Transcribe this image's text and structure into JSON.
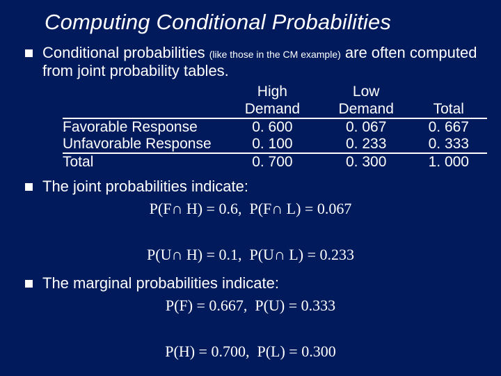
{
  "title": "Computing Conditional Probabilities",
  "bullets": {
    "b1_a": "Conditional probabilities ",
    "b1_small": "(like those in the CM example)",
    "b1_b": " are often computed from joint probability tables.",
    "b2": "The joint probabilities indicate:",
    "b3": "The marginal probabilities indicate:"
  },
  "table": {
    "col1_l1": "High",
    "col1_l2": "Demand",
    "col2_l1": "Low",
    "col2_l2": "Demand",
    "col3_l1": "",
    "col3_l2": "Total",
    "rows": [
      {
        "label": "Favorable Response",
        "c1": "0. 600",
        "c2": "0. 067",
        "c3": "0. 667"
      },
      {
        "label": "Unfavorable Response",
        "c1": "0. 100",
        "c2": "0. 233",
        "c3": "0. 333"
      },
      {
        "label": "Total",
        "c1": "0. 700",
        "c2": "0. 300",
        "c3": "1. 000"
      }
    ]
  },
  "formulas": {
    "joint_line1": "P(F∩ H) = 0.6,  P(F∩ L) = 0.067",
    "joint_line2": "P(U∩ H) = 0.1,  P(U∩ L) = 0.233",
    "marg_line1": "P(F) = 0.667,  P(U) = 0.333",
    "marg_line2": "P(H) = 0.700,  P(L) = 0.300"
  },
  "chart_data": {
    "type": "table",
    "title": "Joint probability table",
    "columns": [
      "",
      "High Demand",
      "Low Demand",
      "Total"
    ],
    "rows": [
      [
        "Favorable Response",
        0.6,
        0.067,
        0.667
      ],
      [
        "Unfavorable Response",
        0.1,
        0.233,
        0.333
      ],
      [
        "Total",
        0.7,
        0.3,
        1.0
      ]
    ]
  }
}
